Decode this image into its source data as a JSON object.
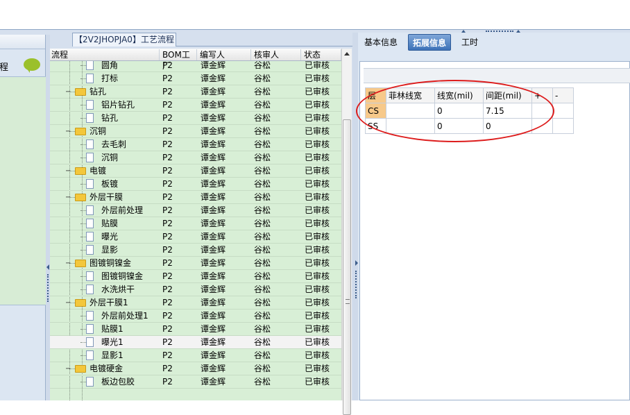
{
  "window": {
    "tab_title": "【2V2JHOPJA0】工艺流程"
  },
  "left_panel": {
    "label": "程"
  },
  "grid": {
    "columns": [
      "流程",
      "BOM工厂",
      "编写人",
      "核审人",
      "状态"
    ],
    "rows": [
      {
        "indent": 2,
        "type": "doc",
        "name": "圆角",
        "bom": "P2",
        "writer": "谭金辉",
        "reviewer": "谷松",
        "status": "已审核",
        "sel": false
      },
      {
        "indent": 2,
        "type": "doc",
        "name": "打标",
        "bom": "P2",
        "writer": "谭金辉",
        "reviewer": "谷松",
        "status": "已审核",
        "sel": false
      },
      {
        "indent": 1,
        "type": "folder",
        "name": "钻孔",
        "bom": "P2",
        "writer": "谭金辉",
        "reviewer": "谷松",
        "status": "已审核",
        "sel": false
      },
      {
        "indent": 2,
        "type": "doc",
        "name": "铝片钻孔",
        "bom": "P2",
        "writer": "谭金辉",
        "reviewer": "谷松",
        "status": "已审核",
        "sel": false
      },
      {
        "indent": 2,
        "type": "doc",
        "name": "钻孔",
        "bom": "P2",
        "writer": "谭金辉",
        "reviewer": "谷松",
        "status": "已审核",
        "sel": false
      },
      {
        "indent": 1,
        "type": "folder",
        "name": "沉铜",
        "bom": "P2",
        "writer": "谭金辉",
        "reviewer": "谷松",
        "status": "已审核",
        "sel": false
      },
      {
        "indent": 2,
        "type": "doc",
        "name": "去毛刺",
        "bom": "P2",
        "writer": "谭金辉",
        "reviewer": "谷松",
        "status": "已审核",
        "sel": false
      },
      {
        "indent": 2,
        "type": "doc",
        "name": "沉铜",
        "bom": "P2",
        "writer": "谭金辉",
        "reviewer": "谷松",
        "status": "已审核",
        "sel": false
      },
      {
        "indent": 1,
        "type": "folder",
        "name": "电镀",
        "bom": "P2",
        "writer": "谭金辉",
        "reviewer": "谷松",
        "status": "已审核",
        "sel": false
      },
      {
        "indent": 2,
        "type": "doc",
        "name": "板镀",
        "bom": "P2",
        "writer": "谭金辉",
        "reviewer": "谷松",
        "status": "已审核",
        "sel": false
      },
      {
        "indent": 1,
        "type": "folder",
        "name": "外层干膜",
        "bom": "P2",
        "writer": "谭金辉",
        "reviewer": "谷松",
        "status": "已审核",
        "sel": false
      },
      {
        "indent": 2,
        "type": "doc",
        "name": "外层前处理",
        "bom": "P2",
        "writer": "谭金辉",
        "reviewer": "谷松",
        "status": "已审核",
        "sel": false
      },
      {
        "indent": 2,
        "type": "doc",
        "name": "贴膜",
        "bom": "P2",
        "writer": "谭金辉",
        "reviewer": "谷松",
        "status": "已审核",
        "sel": false
      },
      {
        "indent": 2,
        "type": "doc",
        "name": "曝光",
        "bom": "P2",
        "writer": "谭金辉",
        "reviewer": "谷松",
        "status": "已审核",
        "sel": false
      },
      {
        "indent": 2,
        "type": "doc",
        "name": "显影",
        "bom": "P2",
        "writer": "谭金辉",
        "reviewer": "谷松",
        "status": "已审核",
        "sel": false
      },
      {
        "indent": 1,
        "type": "folder",
        "name": "图镀铜镍金",
        "bom": "P2",
        "writer": "谭金辉",
        "reviewer": "谷松",
        "status": "已审核",
        "sel": false
      },
      {
        "indent": 2,
        "type": "doc",
        "name": "图镀铜镍金",
        "bom": "P2",
        "writer": "谭金辉",
        "reviewer": "谷松",
        "status": "已审核",
        "sel": false
      },
      {
        "indent": 2,
        "type": "doc",
        "name": "水洗烘干",
        "bom": "P2",
        "writer": "谭金辉",
        "reviewer": "谷松",
        "status": "已审核",
        "sel": false
      },
      {
        "indent": 1,
        "type": "folder",
        "name": "外层干膜1",
        "bom": "P2",
        "writer": "谭金辉",
        "reviewer": "谷松",
        "status": "已审核",
        "sel": false
      },
      {
        "indent": 2,
        "type": "doc",
        "name": "外层前处理1",
        "bom": "P2",
        "writer": "谭金辉",
        "reviewer": "谷松",
        "status": "已审核",
        "sel": false
      },
      {
        "indent": 2,
        "type": "doc",
        "name": "贴膜1",
        "bom": "P2",
        "writer": "谭金辉",
        "reviewer": "谷松",
        "status": "已审核",
        "sel": false
      },
      {
        "indent": 2,
        "type": "doc",
        "name": "曝光1",
        "bom": "P2",
        "writer": "谭金辉",
        "reviewer": "谷松",
        "status": "已审核",
        "sel": true
      },
      {
        "indent": 2,
        "type": "doc",
        "name": "显影1",
        "bom": "P2",
        "writer": "谭金辉",
        "reviewer": "谷松",
        "status": "已审核",
        "sel": false
      },
      {
        "indent": 1,
        "type": "folder",
        "name": "电镀硬金",
        "bom": "P2",
        "writer": "谭金辉",
        "reviewer": "谷松",
        "status": "已审核",
        "sel": false
      },
      {
        "indent": 2,
        "type": "doc",
        "name": "板边包胶",
        "bom": "P2",
        "writer": "谭金辉",
        "reviewer": "谷松",
        "status": "已审核",
        "sel": false
      }
    ]
  },
  "right_panel": {
    "tabs": [
      "基本信息",
      "拓展信息",
      "工时"
    ],
    "active_tab": 1,
    "table": {
      "headers": [
        "层",
        "菲林线宽",
        "线宽(mil)",
        "间距(mil)",
        "+",
        "-"
      ],
      "rows": [
        {
          "layer": "CS",
          "film": "",
          "width": "0",
          "spacing": "7.15"
        },
        {
          "layer": "SS",
          "film": "",
          "width": "0",
          "spacing": "0"
        }
      ]
    }
  }
}
